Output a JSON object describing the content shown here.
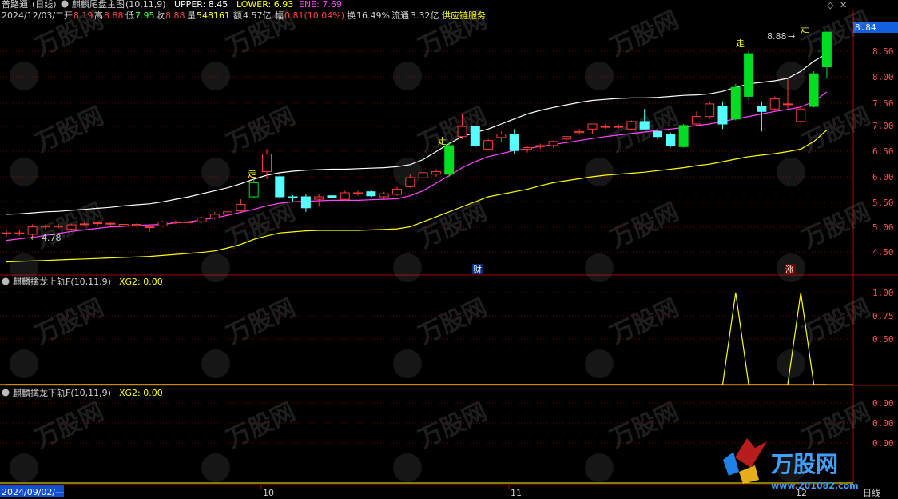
{
  "header": {
    "app": "普路通",
    "period": "(日线)",
    "indicator_name": "麒麟尾盘主图",
    "indicator_params": "(10,11,9)",
    "upper_label": "UPPER: 8.45",
    "lower_label": "LOWER: 6.93",
    "ene_label": "ENE: 7.69",
    "upper_color": "#ffffff",
    "lower_color": "#ffff00",
    "ene_color": "#ff44ff"
  },
  "quote": {
    "date": "2024/12/03/二",
    "open_label": "开",
    "open": "8.19",
    "high_label": "高",
    "high": "8.88",
    "low_label": "低",
    "low": "7.95",
    "close_label": "收",
    "close": "8.88",
    "volume_label": "量",
    "volume": "548161",
    "amount_label": "额",
    "amount": "4.57亿",
    "change_label": "幅",
    "change": "0.81(10.04%)",
    "turnover_label": "换",
    "turnover": "16.49%",
    "float_label": "流通",
    "float_cap": "3.32亿",
    "sector": "供应链服务"
  },
  "main_axis": {
    "labels": [
      "8.84",
      "8.50",
      "8.00",
      "7.50",
      "7.00",
      "6.50",
      "6.00",
      "5.50",
      "5.00",
      "4.50"
    ],
    "current_price": "8.84",
    "ylim": [
      4.35,
      9.0
    ]
  },
  "annotations": {
    "low_marker": "4.78",
    "high_marker": "8.88",
    "walk_mark": "走",
    "caibao_mark": "财",
    "zhang_mark": "涨"
  },
  "sub1": {
    "title": "麒麟擒龙上轨F(10,11,9)",
    "value_label": "XG2: 0.00",
    "axis_labels": [
      "1.00",
      "0.75",
      "0.50"
    ]
  },
  "sub2": {
    "title": "麒麟擒龙下轨F(10,11,9)",
    "value_label": "XG2: 0.00",
    "axis_labels": [
      "0.00",
      "0.00",
      "0.00"
    ]
  },
  "time_axis": {
    "start_date": "2024/09/02/—",
    "month_labels": [
      "10",
      "11",
      "12"
    ],
    "period_tab": "日线"
  },
  "watermark": {
    "brand": "万股网",
    "url": "www.201082.com"
  },
  "chart_data": {
    "type": "candlestick",
    "candles": [
      {
        "o": 4.88,
        "h": 4.95,
        "l": 4.8,
        "c": 4.88
      },
      {
        "o": 4.88,
        "h": 4.93,
        "l": 4.82,
        "c": 4.88
      },
      {
        "o": 4.85,
        "h": 5.05,
        "l": 4.78,
        "c": 5.0
      },
      {
        "o": 5.0,
        "h": 5.05,
        "l": 4.95,
        "c": 5.02
      },
      {
        "o": 5.0,
        "h": 5.05,
        "l": 4.97,
        "c": 5.02
      },
      {
        "o": 4.95,
        "h": 5.06,
        "l": 4.92,
        "c": 5.04
      },
      {
        "o": 5.05,
        "h": 5.1,
        "l": 5.02,
        "c": 5.06
      },
      {
        "o": 5.07,
        "h": 5.1,
        "l": 5.02,
        "c": 5.08
      },
      {
        "o": 5.06,
        "h": 5.1,
        "l": 5.03,
        "c": 5.07
      },
      {
        "o": 5.02,
        "h": 5.06,
        "l": 5.0,
        "c": 5.05
      },
      {
        "o": 5.03,
        "h": 5.07,
        "l": 5.0,
        "c": 5.05
      },
      {
        "o": 5.0,
        "h": 5.04,
        "l": 4.9,
        "c": 5.0
      },
      {
        "o": 5.02,
        "h": 5.12,
        "l": 5.0,
        "c": 5.1
      },
      {
        "o": 5.09,
        "h": 5.13,
        "l": 5.06,
        "c": 5.1
      },
      {
        "o": 5.1,
        "h": 5.12,
        "l": 5.05,
        "c": 5.1
      },
      {
        "o": 5.1,
        "h": 5.2,
        "l": 5.08,
        "c": 5.18
      },
      {
        "o": 5.18,
        "h": 5.3,
        "l": 5.15,
        "c": 5.25
      },
      {
        "o": 5.25,
        "h": 5.32,
        "l": 5.22,
        "c": 5.3
      },
      {
        "o": 5.32,
        "h": 5.55,
        "l": 5.3,
        "c": 5.45
      },
      {
        "o": 5.6,
        "h": 5.95,
        "l": 5.57,
        "c": 5.88
      },
      {
        "o": 6.1,
        "h": 6.55,
        "l": 5.95,
        "c": 6.45
      },
      {
        "o": 6.0,
        "h": 6.05,
        "l": 5.55,
        "c": 5.6
      },
      {
        "o": 5.6,
        "h": 5.63,
        "l": 5.5,
        "c": 5.58
      },
      {
        "o": 5.6,
        "h": 5.65,
        "l": 5.3,
        "c": 5.38
      },
      {
        "o": 5.55,
        "h": 5.65,
        "l": 5.4,
        "c": 5.6
      },
      {
        "o": 5.62,
        "h": 5.7,
        "l": 5.55,
        "c": 5.58
      },
      {
        "o": 5.55,
        "h": 5.72,
        "l": 5.52,
        "c": 5.68
      },
      {
        "o": 5.68,
        "h": 5.72,
        "l": 5.62,
        "c": 5.68
      },
      {
        "o": 5.7,
        "h": 5.72,
        "l": 5.6,
        "c": 5.62
      },
      {
        "o": 5.6,
        "h": 5.7,
        "l": 5.55,
        "c": 5.66
      },
      {
        "o": 5.65,
        "h": 5.8,
        "l": 5.62,
        "c": 5.75
      },
      {
        "o": 5.8,
        "h": 6.05,
        "l": 5.78,
        "c": 5.98
      },
      {
        "o": 5.98,
        "h": 6.12,
        "l": 5.9,
        "c": 6.08
      },
      {
        "o": 6.05,
        "h": 6.15,
        "l": 6.0,
        "c": 6.1
      },
      {
        "o": 6.05,
        "h": 6.7,
        "l": 6.0,
        "c": 6.62
      },
      {
        "o": 6.8,
        "h": 7.25,
        "l": 6.75,
        "c": 7.0
      },
      {
        "o": 7.0,
        "h": 7.0,
        "l": 6.58,
        "c": 6.62
      },
      {
        "o": 6.55,
        "h": 6.75,
        "l": 6.52,
        "c": 6.72
      },
      {
        "o": 6.78,
        "h": 6.9,
        "l": 6.7,
        "c": 6.85
      },
      {
        "o": 6.85,
        "h": 6.95,
        "l": 6.45,
        "c": 6.52
      },
      {
        "o": 6.55,
        "h": 6.62,
        "l": 6.48,
        "c": 6.58
      },
      {
        "o": 6.6,
        "h": 6.66,
        "l": 6.55,
        "c": 6.62
      },
      {
        "o": 6.62,
        "h": 6.72,
        "l": 6.58,
        "c": 6.7
      },
      {
        "o": 6.75,
        "h": 6.82,
        "l": 6.7,
        "c": 6.8
      },
      {
        "o": 6.88,
        "h": 6.95,
        "l": 6.85,
        "c": 6.9
      },
      {
        "o": 6.95,
        "h": 7.05,
        "l": 6.85,
        "c": 7.05
      },
      {
        "o": 7.0,
        "h": 7.05,
        "l": 6.95,
        "c": 7.0
      },
      {
        "o": 7.0,
        "h": 7.05,
        "l": 6.95,
        "c": 7.0
      },
      {
        "o": 6.95,
        "h": 7.12,
        "l": 6.92,
        "c": 7.1
      },
      {
        "o": 7.1,
        "h": 7.35,
        "l": 6.95,
        "c": 6.95
      },
      {
        "o": 6.9,
        "h": 6.95,
        "l": 6.75,
        "c": 6.8
      },
      {
        "o": 6.85,
        "h": 6.88,
        "l": 6.58,
        "c": 6.62
      },
      {
        "o": 6.6,
        "h": 7.05,
        "l": 6.58,
        "c": 7.02
      },
      {
        "o": 7.05,
        "h": 7.3,
        "l": 7.0,
        "c": 7.2
      },
      {
        "o": 7.2,
        "h": 7.5,
        "l": 7.15,
        "c": 7.45
      },
      {
        "o": 7.4,
        "h": 7.5,
        "l": 6.95,
        "c": 7.05
      },
      {
        "o": 7.15,
        "h": 7.85,
        "l": 7.12,
        "c": 7.78
      },
      {
        "o": 7.6,
        "h": 8.5,
        "l": 7.52,
        "c": 8.45
      },
      {
        "o": 7.4,
        "h": 7.5,
        "l": 6.9,
        "c": 7.3
      },
      {
        "o": 7.35,
        "h": 7.6,
        "l": 7.3,
        "c": 7.55
      },
      {
        "o": 7.45,
        "h": 7.95,
        "l": 7.35,
        "c": 7.45
      },
      {
        "o": 7.1,
        "h": 7.4,
        "l": 7.05,
        "c": 7.35
      },
      {
        "o": 7.4,
        "h": 8.1,
        "l": 7.38,
        "c": 8.05
      },
      {
        "o": 8.19,
        "h": 8.88,
        "l": 7.95,
        "c": 8.88
      }
    ],
    "upper": [
      5.25,
      5.26,
      5.28,
      5.3,
      5.31,
      5.33,
      5.35,
      5.37,
      5.39,
      5.42,
      5.44,
      5.46,
      5.5,
      5.55,
      5.6,
      5.66,
      5.72,
      5.78,
      5.86,
      5.95,
      6.03,
      6.08,
      6.11,
      6.13,
      6.14,
      6.15,
      6.15,
      6.16,
      6.17,
      6.18,
      6.2,
      6.24,
      6.34,
      6.5,
      6.66,
      6.8,
      6.88,
      6.95,
      7.05,
      7.15,
      7.25,
      7.32,
      7.38,
      7.43,
      7.48,
      7.52,
      7.54,
      7.56,
      7.57,
      7.57,
      7.58,
      7.6,
      7.62,
      7.63,
      7.65,
      7.7,
      7.78,
      7.85,
      7.88,
      7.91,
      7.96,
      8.1,
      8.3,
      8.45
    ],
    "ene": [
      4.73,
      4.76,
      4.79,
      4.83,
      4.87,
      4.91,
      4.94,
      4.97,
      5.0,
      5.01,
      5.03,
      5.04,
      5.05,
      5.08,
      5.1,
      5.14,
      5.18,
      5.23,
      5.29,
      5.35,
      5.42,
      5.47,
      5.5,
      5.51,
      5.52,
      5.53,
      5.53,
      5.53,
      5.54,
      5.55,
      5.56,
      5.62,
      5.72,
      5.87,
      6.02,
      6.18,
      6.3,
      6.4,
      6.46,
      6.52,
      6.56,
      6.6,
      6.64,
      6.68,
      6.72,
      6.76,
      6.8,
      6.83,
      6.86,
      6.89,
      6.92,
      6.95,
      6.98,
      7.02,
      7.05,
      7.1,
      7.15,
      7.2,
      7.25,
      7.3,
      7.34,
      7.39,
      7.5,
      7.69
    ],
    "lower": [
      4.3,
      4.31,
      4.32,
      4.33,
      4.34,
      4.35,
      4.36,
      4.37,
      4.38,
      4.39,
      4.4,
      4.41,
      4.43,
      4.45,
      4.47,
      4.49,
      4.52,
      4.58,
      4.65,
      4.75,
      4.82,
      4.88,
      4.9,
      4.92,
      4.93,
      4.93,
      4.93,
      4.93,
      4.94,
      4.95,
      4.96,
      5.0,
      5.1,
      5.2,
      5.3,
      5.4,
      5.5,
      5.6,
      5.65,
      5.7,
      5.75,
      5.82,
      5.88,
      5.92,
      5.96,
      6.0,
      6.03,
      6.05,
      6.07,
      6.09,
      6.12,
      6.15,
      6.18,
      6.22,
      6.25,
      6.3,
      6.35,
      6.4,
      6.43,
      6.46,
      6.5,
      6.55,
      6.7,
      6.93
    ],
    "sub1_values": [
      0,
      0,
      0,
      0,
      0,
      0,
      0,
      0,
      0,
      0,
      0,
      0,
      0,
      0,
      0,
      0,
      0,
      0,
      0,
      0,
      0,
      0,
      0,
      0,
      0,
      0,
      0,
      0,
      0,
      0,
      0,
      0,
      0,
      0,
      0,
      0,
      0,
      0,
      0,
      0,
      0,
      0,
      0,
      0,
      0,
      0,
      0,
      0,
      0,
      0,
      0,
      0,
      0,
      0,
      0,
      0,
      1,
      0,
      0,
      0,
      0,
      1,
      0,
      0
    ],
    "sub1_ylim": [
      0,
      1.0
    ]
  }
}
